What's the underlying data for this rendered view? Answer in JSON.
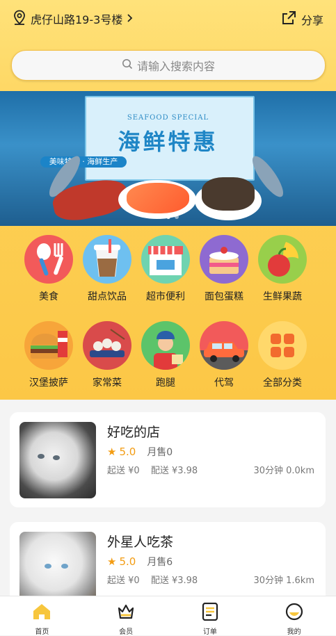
{
  "header": {
    "location": "虎仔山路19-3号楼",
    "share_label": "分享"
  },
  "search": {
    "placeholder": "请输入搜索内容"
  },
  "banner": {
    "english_title": "SEAFOOD SPECIAL",
    "title": "海鲜特惠",
    "tagline": "美味特色 · 海鲜生产",
    "slide_count": 3,
    "active_slide": 1
  },
  "categories": [
    {
      "label": "美食",
      "icon": "fork-spoon-icon",
      "color": "#f25a5a"
    },
    {
      "label": "甜点饮品",
      "icon": "drink-cup-icon",
      "color": "#6ec0f0"
    },
    {
      "label": "超市便利",
      "icon": "store-icon",
      "color": "#6fd3b0"
    },
    {
      "label": "面包蛋糕",
      "icon": "cake-icon",
      "color": "#8e6ad1"
    },
    {
      "label": "生鲜果蔬",
      "icon": "fruit-icon",
      "color": "#98cf4b"
    },
    {
      "label": "汉堡披萨",
      "icon": "burger-icon",
      "color": "#f7a53a"
    },
    {
      "label": "家常菜",
      "icon": "dumpling-icon",
      "color": "#d94b4b"
    },
    {
      "label": "跑腿",
      "icon": "courier-icon",
      "color": "#5cc46a"
    },
    {
      "label": "代驾",
      "icon": "car-icon",
      "color": "#f25a5a"
    },
    {
      "label": "全部分类",
      "icon": "grid-icon",
      "color": "#ffd86b"
    }
  ],
  "stores": [
    {
      "name": "好吃的店",
      "rating": "5.0",
      "sales": "月售0",
      "min_order": "起送 ¥0",
      "delivery_fee": "配送 ¥3.98",
      "eta": "30分钟 0.0km"
    },
    {
      "name": "外星人吃茶",
      "rating": "5.0",
      "sales": "月售6",
      "min_order": "起送 ¥0",
      "delivery_fee": "配送 ¥3.98",
      "eta": "30分钟 1.6km"
    }
  ],
  "tabbar": [
    {
      "label": "首页",
      "icon": "home-icon"
    },
    {
      "label": "会员",
      "icon": "vip-icon"
    },
    {
      "label": "订单",
      "icon": "order-icon"
    },
    {
      "label": "我的",
      "icon": "profile-icon"
    }
  ],
  "colors": {
    "accent": "#fcc746",
    "star": "#f39c12"
  }
}
